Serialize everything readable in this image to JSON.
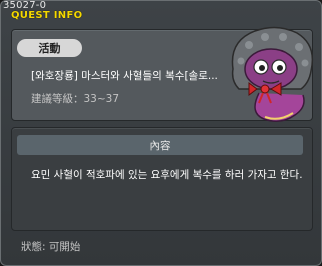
{
  "debug_id": "35027-0",
  "title": "QUEST INFO",
  "quest": {
    "tag": "活動",
    "name": "[와호장룡] 마스터와 사혈들의 복수[솔로...",
    "level_label": "建議等級：33~37"
  },
  "details": {
    "header": "內容",
    "description": "요민 사혈이 적호파에 있는 요후에게 복수를 하러 가자고 한다."
  },
  "status_label": "狀態: 可開始",
  "colors": {
    "title": "#f5d800",
    "panel": "#54595d",
    "section_header": "#5a656c"
  }
}
